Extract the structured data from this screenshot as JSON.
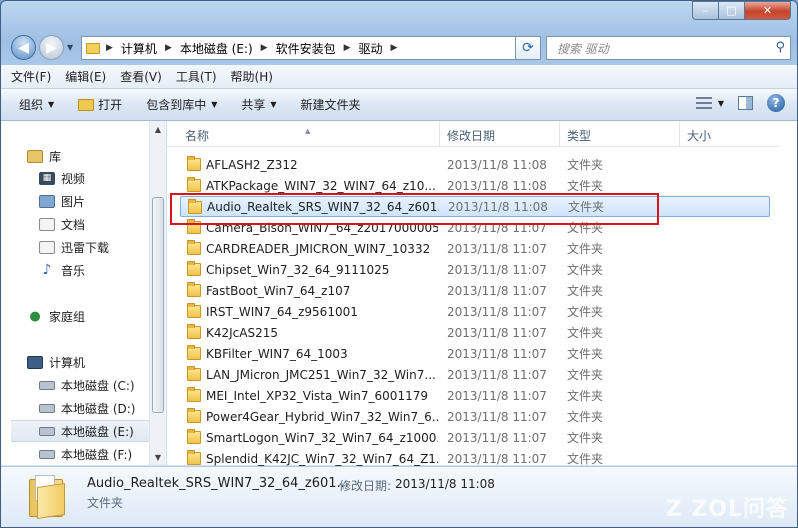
{
  "window": {
    "caption": {
      "minimize": "–",
      "maximize": "□",
      "close": "✕"
    }
  },
  "address": {
    "crumbs": [
      "计算机",
      "本地磁盘 (E:)",
      "软件安装包",
      "驱动"
    ],
    "search_placeholder": "搜索 驱动"
  },
  "menu": [
    "文件(F)",
    "编辑(E)",
    "查看(V)",
    "工具(T)",
    "帮助(H)"
  ],
  "toolbar": {
    "organize": "组织",
    "open": "打开",
    "include": "包含到库中",
    "share": "共享",
    "new_folder": "新建文件夹"
  },
  "nav": {
    "library": "库",
    "video": "视频",
    "pictures": "图片",
    "docs": "文档",
    "xunlei": "迅雷下载",
    "music": "音乐",
    "homegroup": "家庭组",
    "computer": "计算机",
    "c": "本地磁盘 (C:)",
    "d": "本地磁盘 (D:)",
    "e": "本地磁盘 (E:)",
    "f": "本地磁盘 (F:)"
  },
  "columns": {
    "name": "名称",
    "date": "修改日期",
    "type": "类型",
    "size": "大小"
  },
  "files": [
    {
      "name": "AFLASH2_Z312",
      "date": "2013/11/8 11:08",
      "type": "文件夹"
    },
    {
      "name": "ATKPackage_WIN7_32_WIN7_64_z10...",
      "date": "2013/11/8 11:08",
      "type": "文件夹"
    },
    {
      "name": "Audio_Realtek_SRS_WIN7_32_64_z601...",
      "date": "2013/11/8 11:08",
      "type": "文件夹"
    },
    {
      "name": "Camera_Bison_WIN7_64_z20170000059",
      "date": "2013/11/8 11:07",
      "type": "文件夹"
    },
    {
      "name": "CARDREADER_JMICRON_WIN7_10332",
      "date": "2013/11/8 11:07",
      "type": "文件夹"
    },
    {
      "name": "Chipset_Win7_32_64_9111025",
      "date": "2013/11/8 11:07",
      "type": "文件夹"
    },
    {
      "name": "FastBoot_Win7_64_z107",
      "date": "2013/11/8 11:07",
      "type": "文件夹"
    },
    {
      "name": "IRST_WIN7_64_z9561001",
      "date": "2013/11/8 11:07",
      "type": "文件夹"
    },
    {
      "name": "K42JcAS215",
      "date": "2013/11/8 11:07",
      "type": "文件夹"
    },
    {
      "name": "KBFilter_WIN7_64_1003",
      "date": "2013/11/8 11:07",
      "type": "文件夹"
    },
    {
      "name": "LAN_JMicron_JMC251_Win7_32_Win7...",
      "date": "2013/11/8 11:07",
      "type": "文件夹"
    },
    {
      "name": "MEI_Intel_XP32_Vista_Win7_6001179",
      "date": "2013/11/8 11:07",
      "type": "文件夹"
    },
    {
      "name": "Power4Gear_Hybrid_Win7_32_Win7_6...",
      "date": "2013/11/8 11:07",
      "type": "文件夹"
    },
    {
      "name": "SmartLogon_Win7_32_Win7_64_z1000...",
      "date": "2013/11/8 11:07",
      "type": "文件夹"
    },
    {
      "name": "Splendid_K42JC_Win7_32_Win7_64_Z1...",
      "date": "2013/11/8 11:07",
      "type": "文件夹"
    }
  ],
  "details": {
    "name": "Audio_Realtek_SRS_WIN7_32_64_z601...",
    "date_label": "修改日期:",
    "date": "2013/11/8 11:08",
    "type": "文件夹"
  },
  "watermark": "Z ZOL问答",
  "colors": {
    "selection_border": "#84acdd",
    "highlight_box": "#d9141c"
  }
}
